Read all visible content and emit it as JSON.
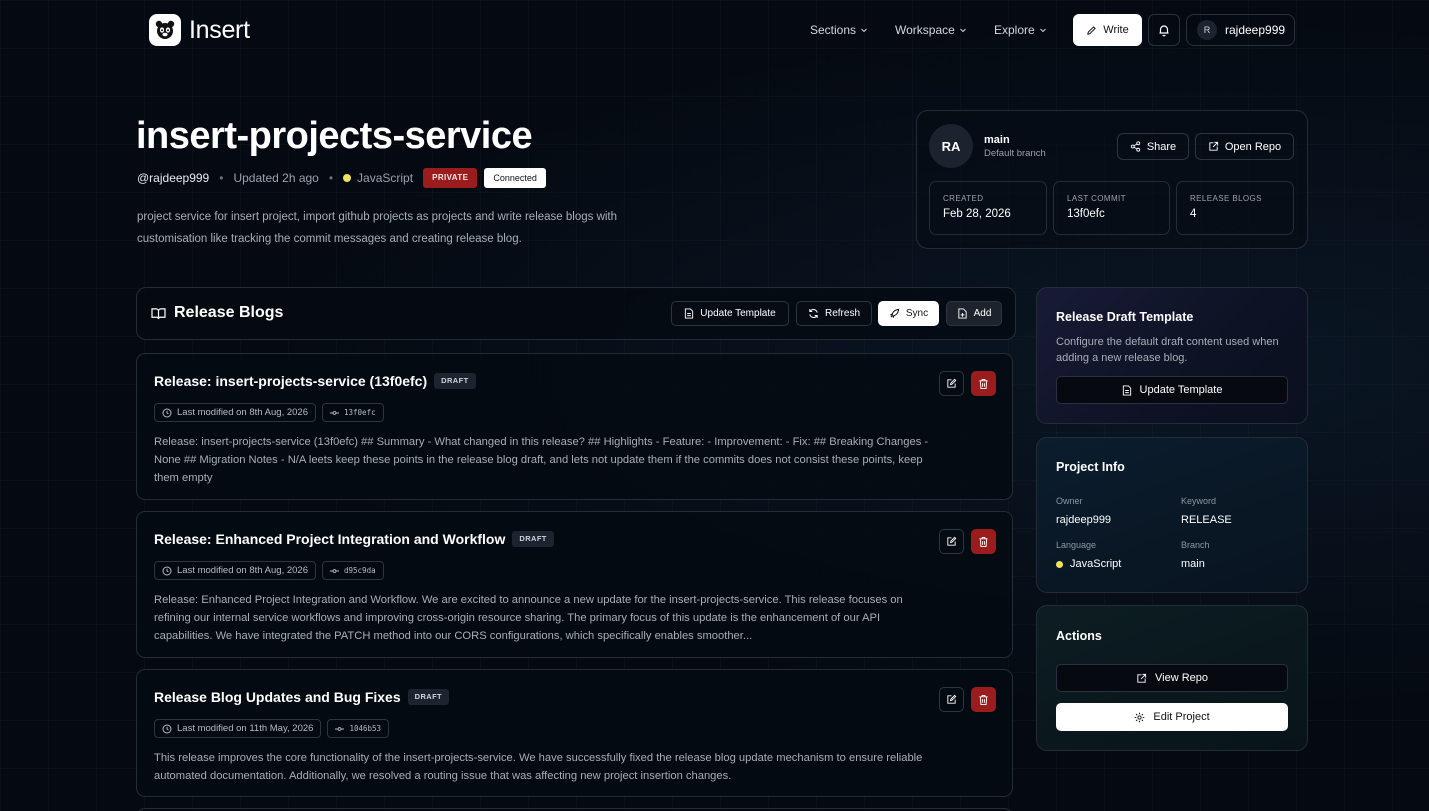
{
  "app": {
    "name": "Insert"
  },
  "nav": {
    "items": [
      "Sections",
      "Workspace",
      "Explore"
    ],
    "write_label": "Write",
    "user_initial": "R",
    "username": "rajdeep999"
  },
  "project": {
    "title": "insert-projects-service",
    "handle": "@rajdeep999",
    "updated": "Updated 2h ago",
    "language": "JavaScript",
    "visibility": "PRIVATE",
    "status": "Connected",
    "description": "project service for insert project, import github projects as projects and write release blogs with customisation like tracking the commit messages and creating release blog."
  },
  "repo_card": {
    "avatar": "RA",
    "branch": "main",
    "branch_sub": "Default branch",
    "share_label": "Share",
    "open_repo_label": "Open Repo",
    "stats": [
      {
        "label": "CREATED",
        "value": "Feb 28, 2026"
      },
      {
        "label": "LAST COMMIT",
        "value": "13f0efc"
      },
      {
        "label": "RELEASE BLOGS",
        "value": "4"
      }
    ]
  },
  "release_blogs": {
    "title": "Release Blogs",
    "toolbar": {
      "update_template": "Update Template",
      "refresh": "Refresh",
      "sync": "Sync",
      "add": "Add"
    },
    "posts": [
      {
        "title": "Release: insert-projects-service (13f0efc)",
        "badge": "DRAFT",
        "modified": "Last modified on 8th Aug, 2026",
        "commit": "13f0efc",
        "body": "Release: insert-projects-service (13f0efc) ## Summary - What changed in this release? ## Highlights - Feature: - Improvement: - Fix: ## Breaking Changes - None ## Migration Notes - N/A leets keep these points in the release blog draft, and lets not update them if the commits does not consist these points, keep them empty"
      },
      {
        "title": "Release: Enhanced Project Integration and Workflow",
        "badge": "DRAFT",
        "modified": "Last modified on 8th Aug, 2026",
        "commit": "d95c9da",
        "body": "Release: Enhanced Project Integration and Workflow. We are excited to announce a new update for the insert-projects-service. This release focuses on refining our internal service workflows and improving cross-origin resource sharing. The primary focus of this update is the enhancement of our API capabilities. We have integrated the PATCH method into our CORS configurations, which specifically enables smoother..."
      },
      {
        "title": "Release Blog Updates and Bug Fixes",
        "badge": "DRAFT",
        "modified": "Last modified on 11th May, 2026",
        "commit": "1046b53",
        "body": "This release improves the core functionality of the insert-projects-service. We have successfully fixed the release blog update mechanism to ensure reliable automated documentation. Additionally, we resolved a routing issue that was affecting new project insertion changes."
      }
    ]
  },
  "template_card": {
    "title": "Release Draft Template",
    "description": "Configure the default draft content used when adding a new release blog.",
    "button": "Update Template"
  },
  "project_info": {
    "title": "Project Info",
    "owner_label": "Owner",
    "owner": "rajdeep999",
    "keyword_label": "Keyword",
    "keyword": "RELEASE",
    "language_label": "Language",
    "language": "JavaScript",
    "branch_label": "Branch",
    "branch": "main"
  },
  "actions": {
    "title": "Actions",
    "view_repo": "View Repo",
    "edit_project": "Edit Project"
  },
  "colors": {
    "background": "#050a12",
    "danger": "#9b1c1c",
    "javascript": "#f1e05a"
  }
}
